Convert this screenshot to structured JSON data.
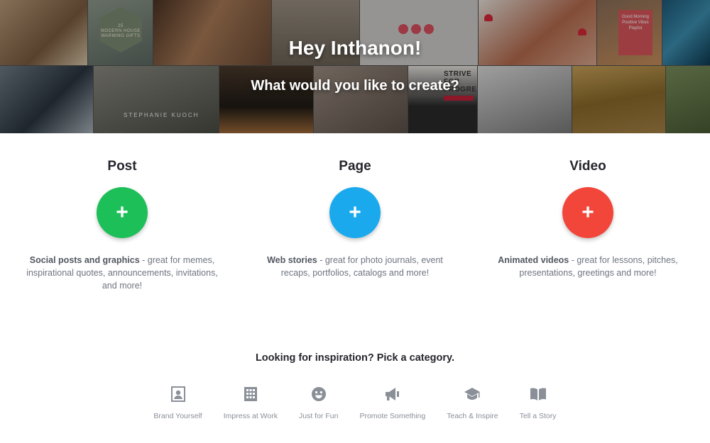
{
  "hero": {
    "title": "Hey Inthanon!",
    "subtitle": "What would you like to create?",
    "tile_texts": {
      "badge": "MODERN HOUSE WARMING GIFTS",
      "badge_number": "25",
      "strive": "STRIVE FOR PROGRESS",
      "stephanie": "STEPHANIE KUOCH",
      "pink_sign": "Good Morning Positive Vibes Playlist"
    }
  },
  "options": [
    {
      "title": "Post",
      "color": "#1dbf59",
      "button_label": "+",
      "desc_bold": "Social posts and graphics",
      "desc_rest": " - great for memes, inspirational quotes, announcements, invitations, and more!"
    },
    {
      "title": "Page",
      "color": "#1aa9ec",
      "button_label": "+",
      "desc_bold": "Web stories",
      "desc_rest": " - great for photo journals, event recaps, portfolios, catalogs and more!"
    },
    {
      "title": "Video",
      "color": "#f2463a",
      "button_label": "+",
      "desc_bold": "Animated videos",
      "desc_rest": " - great for lessons, pitches, presentations, greetings and more!"
    }
  ],
  "inspiration": {
    "title": "Looking for inspiration? Pick a category.",
    "icon_color": "#8a8f98",
    "categories": [
      {
        "label": "Brand Yourself",
        "icon": "portrait-icon"
      },
      {
        "label": "Impress at Work",
        "icon": "building-icon"
      },
      {
        "label": "Just for Fun",
        "icon": "smiley-icon"
      },
      {
        "label": "Promote Something",
        "icon": "megaphone-icon"
      },
      {
        "label": "Teach & Inspire",
        "icon": "graduation-cap-icon"
      },
      {
        "label": "Tell a Story",
        "icon": "book-icon"
      }
    ]
  }
}
